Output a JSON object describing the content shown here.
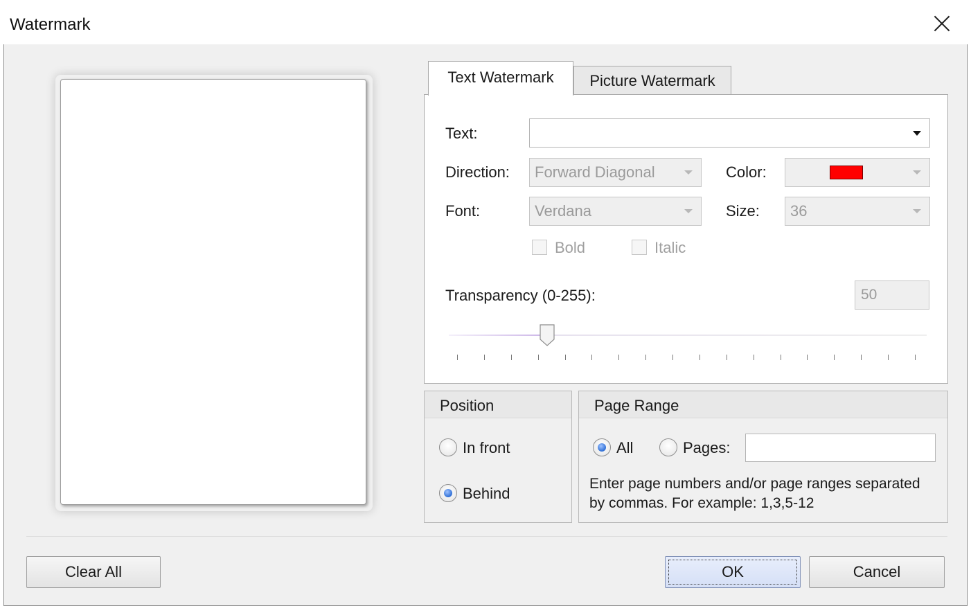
{
  "window": {
    "title": "Watermark"
  },
  "tabs": [
    {
      "label": "Text Watermark",
      "active": true
    },
    {
      "label": "Picture Watermark",
      "active": false
    }
  ],
  "text_tab": {
    "text_label": "Text:",
    "text_value": "",
    "direction_label": "Direction:",
    "direction_value": "Forward Diagonal",
    "color_label": "Color:",
    "color_value": "#ff0000",
    "font_label": "Font:",
    "font_value": "Verdana",
    "size_label": "Size:",
    "size_value": "36",
    "bold_label": "Bold",
    "bold_checked": false,
    "italic_label": "Italic",
    "italic_checked": false,
    "transparency_label": "Transparency (0-255):",
    "transparency_value": "50",
    "slider_min": 0,
    "slider_max": 255,
    "slider_value": 50,
    "slider_tick_count": 18
  },
  "position": {
    "title": "Position",
    "options": [
      {
        "label": "In front",
        "selected": false
      },
      {
        "label": "Behind",
        "selected": true
      }
    ]
  },
  "page_range": {
    "title": "Page Range",
    "all_label": "All",
    "all_selected": true,
    "pages_label": "Pages:",
    "pages_selected": false,
    "pages_value": "",
    "hint": "Enter page numbers and/or page ranges separated by commas. For example: 1,3,5-12"
  },
  "buttons": {
    "clear_all": "Clear All",
    "ok": "OK",
    "cancel": "Cancel"
  },
  "icons": {
    "close": "close-icon",
    "dropdown": "chevron-down-icon"
  }
}
